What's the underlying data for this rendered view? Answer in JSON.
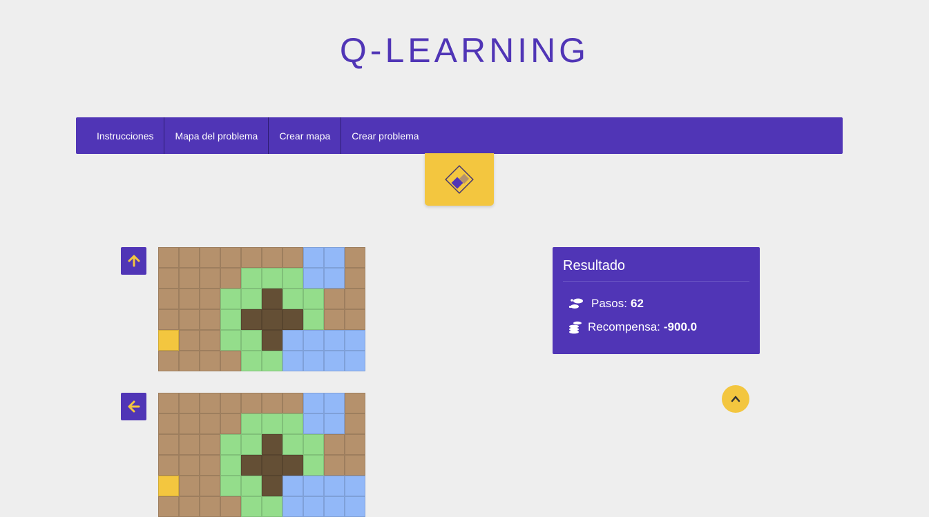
{
  "header": {
    "title": "Q-LEARNING"
  },
  "nav": {
    "items": [
      {
        "label": "Instrucciones"
      },
      {
        "label": "Mapa del problema"
      },
      {
        "label": "Crear mapa"
      },
      {
        "label": "Crear problema"
      }
    ]
  },
  "logo": {
    "icon": "diamond-check-logo"
  },
  "steps": [
    {
      "direction": "up",
      "icon": "arrow-up-icon"
    },
    {
      "direction": "left",
      "icon": "arrow-left-icon"
    }
  ],
  "map": {
    "legend": {
      "s": "sand",
      "g": "grass",
      "d": "dirt",
      "w": "water",
      "y": "agent"
    },
    "colors": {
      "s": "#b5916c",
      "g": "#94dd8b",
      "d": "#644f35",
      "w": "#92b8f8",
      "y": "#f3c63f"
    },
    "rows": [
      "ssssssswws",
      "ssssgggwws",
      "sssggdggss",
      "sssgdddgss",
      "yssggdwwww",
      "ssssggwwww"
    ]
  },
  "result": {
    "title": "Resultado",
    "steps_label": "Pasos:",
    "steps_value": "62",
    "reward_label": "Recompensa:",
    "reward_value": "-900.0"
  },
  "colors": {
    "primary": "#5035b6",
    "accent": "#f3c63f",
    "background": "#eeeeee"
  }
}
